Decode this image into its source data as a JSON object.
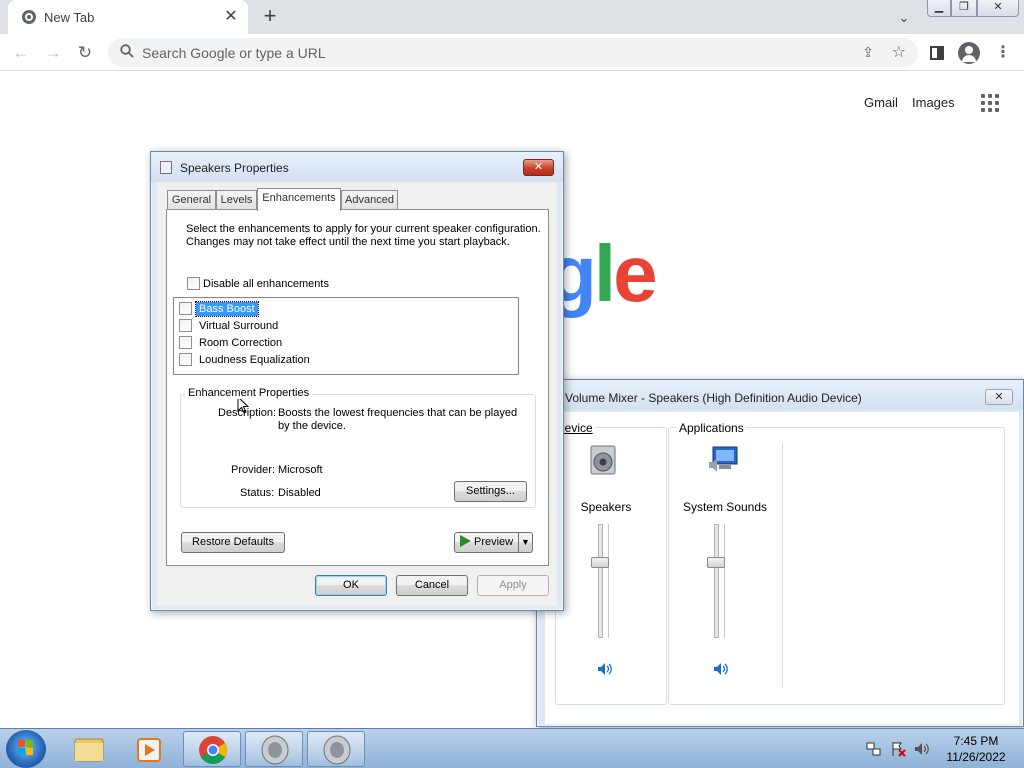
{
  "browser": {
    "tab_title": "New Tab",
    "omnibox_placeholder": "Search Google or type a URL",
    "links": {
      "gmail": "Gmail",
      "images": "Images"
    },
    "logo_visible_letters": [
      "g",
      "l",
      "e"
    ]
  },
  "speakers_dialog": {
    "title": "Speakers Properties",
    "tabs": [
      {
        "label": "General",
        "active": false
      },
      {
        "label": "Levels",
        "active": false
      },
      {
        "label": "Enhancements",
        "active": true
      },
      {
        "label": "Advanced",
        "active": false
      }
    ],
    "intro_text": "Select the enhancements to apply for your current speaker configuration. Changes may not take effect until the next time you start playback.",
    "disable_all_label": "Disable all enhancements",
    "disable_all_checked": false,
    "enhancements": [
      {
        "label": "Bass Boost",
        "checked": false,
        "selected": true
      },
      {
        "label": "Virtual Surround",
        "checked": false,
        "selected": false
      },
      {
        "label": "Room Correction",
        "checked": false,
        "selected": false
      },
      {
        "label": "Loudness Equalization",
        "checked": false,
        "selected": false
      }
    ],
    "properties": {
      "group_title": "Enhancement Properties",
      "description_label": "Description:",
      "description_value": "Boosts the lowest frequencies that can be played by the device.",
      "provider_label": "Provider:",
      "provider_value": "Microsoft",
      "status_label": "Status:",
      "status_value": "Disabled",
      "settings_button": "Settings..."
    },
    "restore_defaults_button": "Restore Defaults",
    "preview_button": "Preview",
    "ok_button": "OK",
    "cancel_button": "Cancel",
    "apply_button": "Apply"
  },
  "volume_mixer": {
    "title": "Volume Mixer - Speakers (High Definition Audio Device)",
    "device_group": "Device",
    "applications_group": "Applications",
    "channels": [
      {
        "name": "Speakers",
        "level": 0.67
      },
      {
        "name": "System Sounds",
        "level": 0.67
      }
    ]
  },
  "taskbar": {
    "time": "7:45 PM",
    "date": "11/26/2022"
  }
}
